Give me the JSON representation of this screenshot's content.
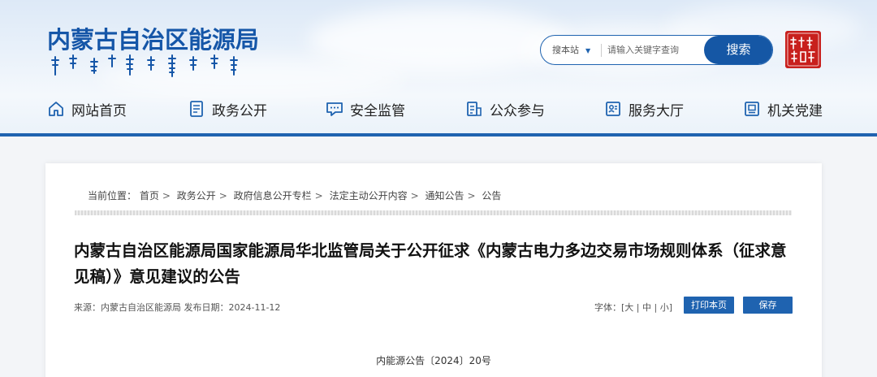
{
  "header": {
    "site_title": "内蒙古自治区能源局",
    "search": {
      "scope_label": "搜本站",
      "placeholder": "请输入关键字查询",
      "button_label": "搜索"
    }
  },
  "nav": {
    "items": [
      {
        "label": "网站首页",
        "icon": "home-icon"
      },
      {
        "label": "政务公开",
        "icon": "document-icon"
      },
      {
        "label": "安全监管",
        "icon": "chat-icon"
      },
      {
        "label": "公众参与",
        "icon": "clipboard-icon"
      },
      {
        "label": "服务大厅",
        "icon": "id-card-icon"
      },
      {
        "label": "机关党建",
        "icon": "badge-icon"
      }
    ]
  },
  "breadcrumb": {
    "prefix": "当前位置：",
    "items": [
      "首页",
      "政务公开",
      "政府信息公开专栏",
      "法定主动公开内容",
      "通知公告",
      "公告"
    ]
  },
  "article": {
    "title": "内蒙古自治区能源局国家能源局华北监管局关于公开征求《内蒙古电力多边交易市场规则体系（征求意见稿）》意见建议的公告",
    "meta": "来源：内蒙古自治区能源局 发布日期：2024-11-12",
    "font_size_label": "字体：[",
    "font_size_options": [
      "大",
      "中",
      "小"
    ],
    "font_size_end": "]",
    "print_label": "打印本页",
    "save_label": "保存",
    "doc_number": "内能源公告〔2024〕20号"
  },
  "colors": {
    "brand_blue": "#1556a8",
    "seal_red": "#c8201d"
  }
}
